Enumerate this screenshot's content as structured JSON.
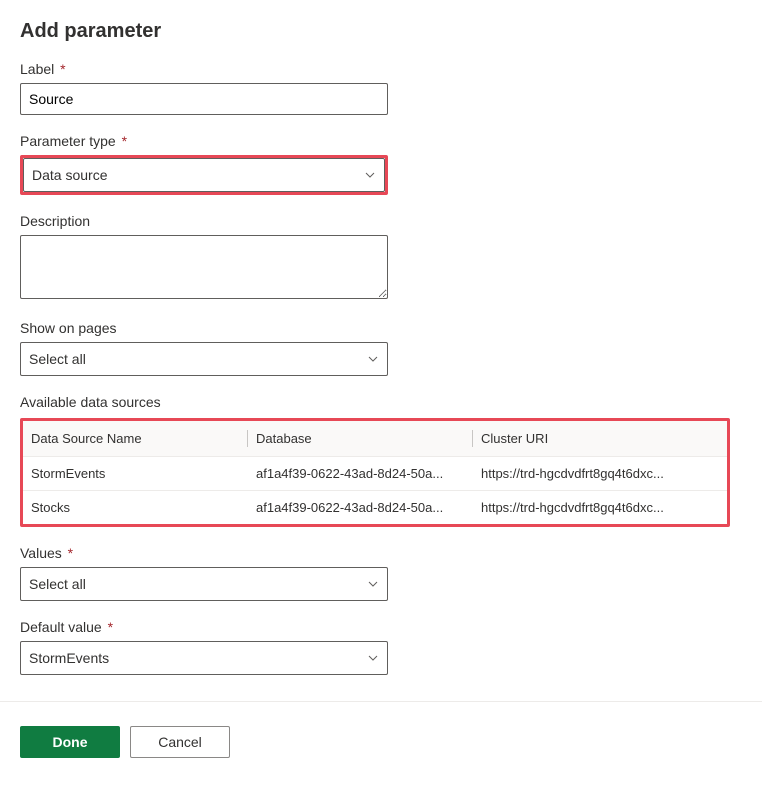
{
  "title": "Add parameter",
  "labelField": {
    "label": "Label",
    "value": "Source"
  },
  "parameterType": {
    "label": "Parameter type",
    "value": "Data source"
  },
  "description": {
    "label": "Description",
    "value": ""
  },
  "showOnPages": {
    "label": "Show on pages",
    "value": "Select all"
  },
  "availableDataSources": {
    "label": "Available data sources",
    "headers": {
      "name": "Data Source Name",
      "database": "Database",
      "clusterUri": "Cluster URI"
    },
    "rows": [
      {
        "name": "StormEvents",
        "database": "af1a4f39-0622-43ad-8d24-50a...",
        "clusterUri": "https://trd-hgcdvdfrt8gq4t6dxc..."
      },
      {
        "name": "Stocks",
        "database": "af1a4f39-0622-43ad-8d24-50a...",
        "clusterUri": "https://trd-hgcdvdfrt8gq4t6dxc..."
      }
    ]
  },
  "values": {
    "label": "Values",
    "value": "Select all"
  },
  "defaultValue": {
    "label": "Default value",
    "value": "StormEvents"
  },
  "buttons": {
    "done": "Done",
    "cancel": "Cancel"
  },
  "requiredMark": "*"
}
